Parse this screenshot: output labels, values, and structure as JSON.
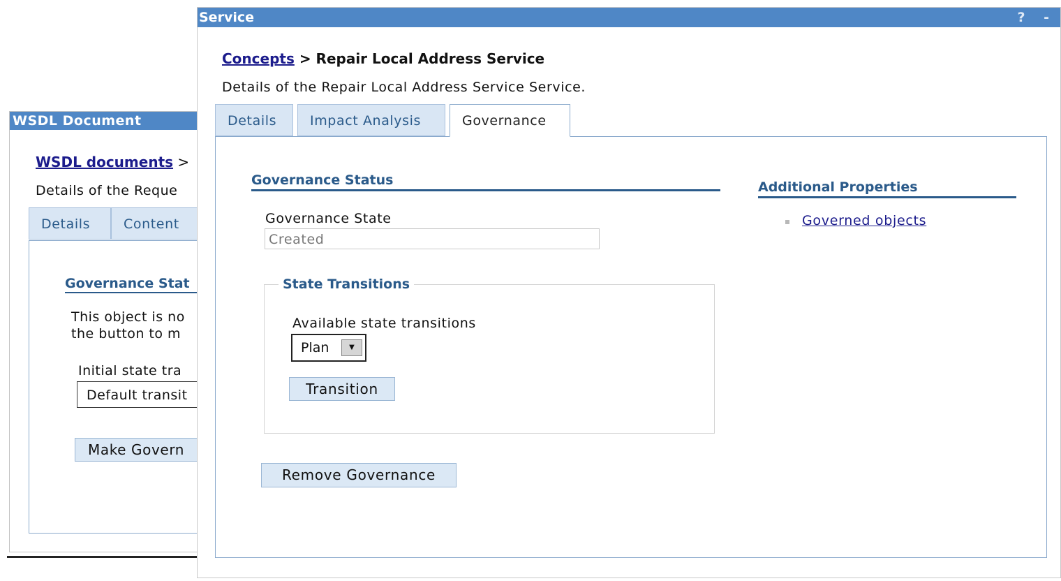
{
  "back_window": {
    "title": "WSDL Document",
    "breadcrumb_link": "WSDL documents",
    "breadcrumb_sep": ">",
    "description": "Details of the Reque",
    "tabs": [
      {
        "label": "Details"
      },
      {
        "label": "Content"
      }
    ],
    "governance_heading": "Governance Stat",
    "note_line1": "This object is no",
    "note_line2": "the button to m",
    "initial_state_label": "Initial state tra",
    "initial_state_value": "Default transit",
    "make_governed_button": "Make Govern"
  },
  "front_window": {
    "title": "Service",
    "title_controls": "? -",
    "breadcrumb_link": "Concepts",
    "breadcrumb_current": "> Repair Local Address Service",
    "description": "Details of the Repair Local Address Service Service.",
    "tabs": [
      {
        "label": "Details",
        "active": false
      },
      {
        "label": "Impact Analysis",
        "active": false
      },
      {
        "label": "Governance",
        "active": true
      }
    ],
    "governance_status_heading": "Governance Status",
    "governance_state_label": "Governance State",
    "governance_state_value": "Created",
    "state_transitions_legend": "State Transitions",
    "available_transitions_label": "Available state transitions",
    "available_transitions_selected": "Plan",
    "transition_button": "Transition",
    "remove_governance_button": "Remove Governance",
    "additional_properties_heading": "Additional Properties",
    "additional_links": [
      {
        "label": "Governed objects"
      }
    ]
  },
  "colors": {
    "titlebar": "#4f87c6",
    "heading": "#2a5a8a",
    "link": "#1c1c8c",
    "button_bg": "#dbe8f5",
    "tab_inactive_bg": "#d9e6f4"
  }
}
